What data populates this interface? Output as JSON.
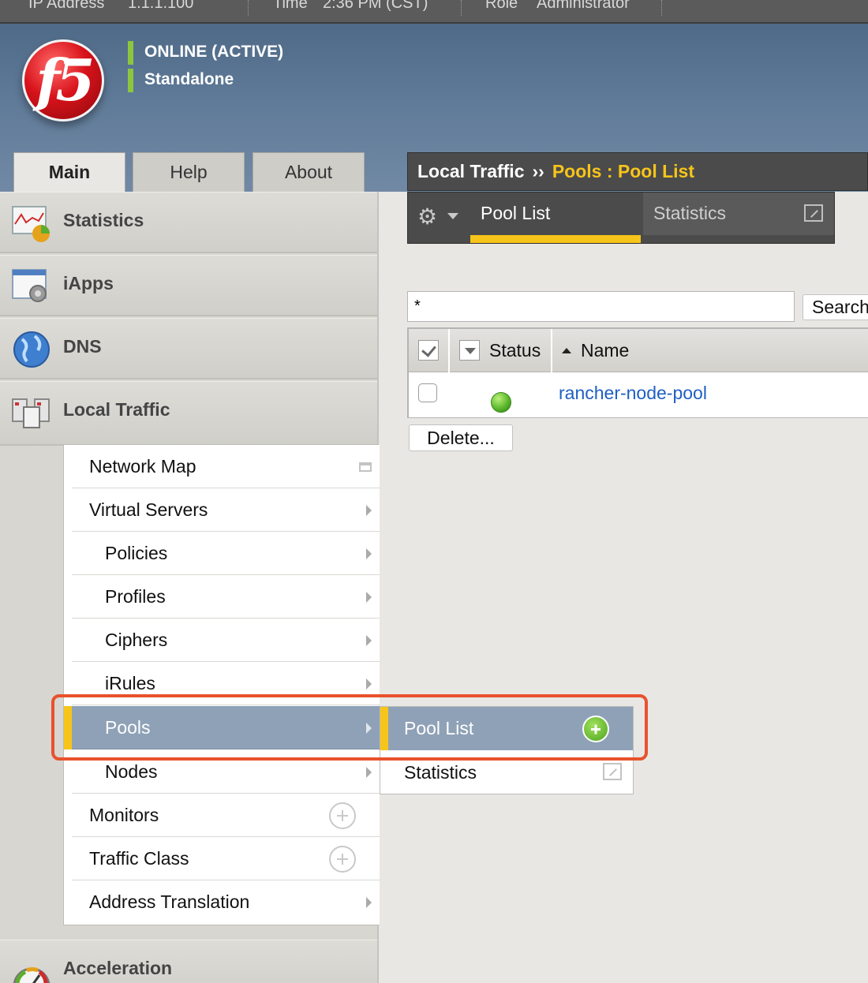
{
  "topbar": {
    "ip_label": "IP Address",
    "ip_value": "1.1.1.100",
    "time_label": "Time",
    "time_value": "2:36 PM (CST)",
    "role_label": "Role",
    "role_value": "Administrator"
  },
  "header": {
    "logo_text": "f5",
    "status_line1": "ONLINE (ACTIVE)",
    "status_line2": "Standalone",
    "status_color": "#8cc63f"
  },
  "main_tabs": [
    {
      "label": "Main",
      "active": true
    },
    {
      "label": "Help",
      "active": false
    },
    {
      "label": "About",
      "active": false
    }
  ],
  "breadcrumb": {
    "section": "Local Traffic",
    "separator": "››",
    "page": "Pools : Pool List"
  },
  "subtabs": {
    "gear_icon": "gear-icon",
    "pool_list": "Pool List",
    "statistics": "Statistics"
  },
  "search": {
    "value": "*",
    "button_label": "Search"
  },
  "table": {
    "columns": [
      "Status",
      "Name"
    ],
    "rows": [
      {
        "status": "available",
        "status_color": "#5cb82e",
        "name": "rancher-node-pool"
      }
    ]
  },
  "actions": {
    "delete_label": "Delete..."
  },
  "sidebar": {
    "sections": [
      {
        "label": "Statistics",
        "icon": "statistics-icon"
      },
      {
        "label": "iApps",
        "icon": "iapps-icon"
      },
      {
        "label": "DNS",
        "icon": "dns-globe-icon"
      },
      {
        "label": "Local Traffic",
        "icon": "local-traffic-icon"
      },
      {
        "label": "Acceleration",
        "icon": "acceleration-gauge-icon"
      }
    ],
    "local_traffic_items": [
      {
        "label": "Network Map"
      },
      {
        "label": "Virtual Servers"
      },
      {
        "label": "Policies"
      },
      {
        "label": "Profiles"
      },
      {
        "label": "Ciphers"
      },
      {
        "label": "iRules"
      },
      {
        "label": "Pools",
        "active": true
      },
      {
        "label": "Nodes"
      },
      {
        "label": "Monitors"
      },
      {
        "label": "Traffic Class"
      },
      {
        "label": "Address Translation"
      }
    ]
  },
  "flyout": {
    "pool_list": "Pool List",
    "statistics": "Statistics"
  },
  "colors": {
    "accent_yellow": "#f7c41a",
    "highlight_red": "#e8522e",
    "active_menu": "#8fa1b7",
    "link_blue": "#1f5fc4"
  }
}
